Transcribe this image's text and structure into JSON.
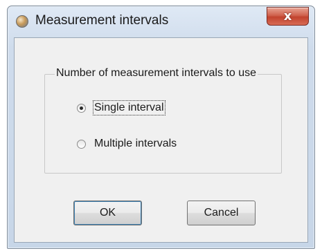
{
  "window": {
    "title": "Measurement intervals",
    "icon": "app-globe-icon",
    "close_glyph": "x"
  },
  "group": {
    "legend": "Number of measurement intervals to use",
    "options": [
      {
        "label": "Single interval",
        "selected": true
      },
      {
        "label": "Multiple intervals",
        "selected": false
      }
    ]
  },
  "buttons": {
    "ok": "OK",
    "cancel": "Cancel"
  },
  "colors": {
    "frame": "#cfdcec",
    "client": "#f0f0f0",
    "close_button": "#c2432e"
  }
}
